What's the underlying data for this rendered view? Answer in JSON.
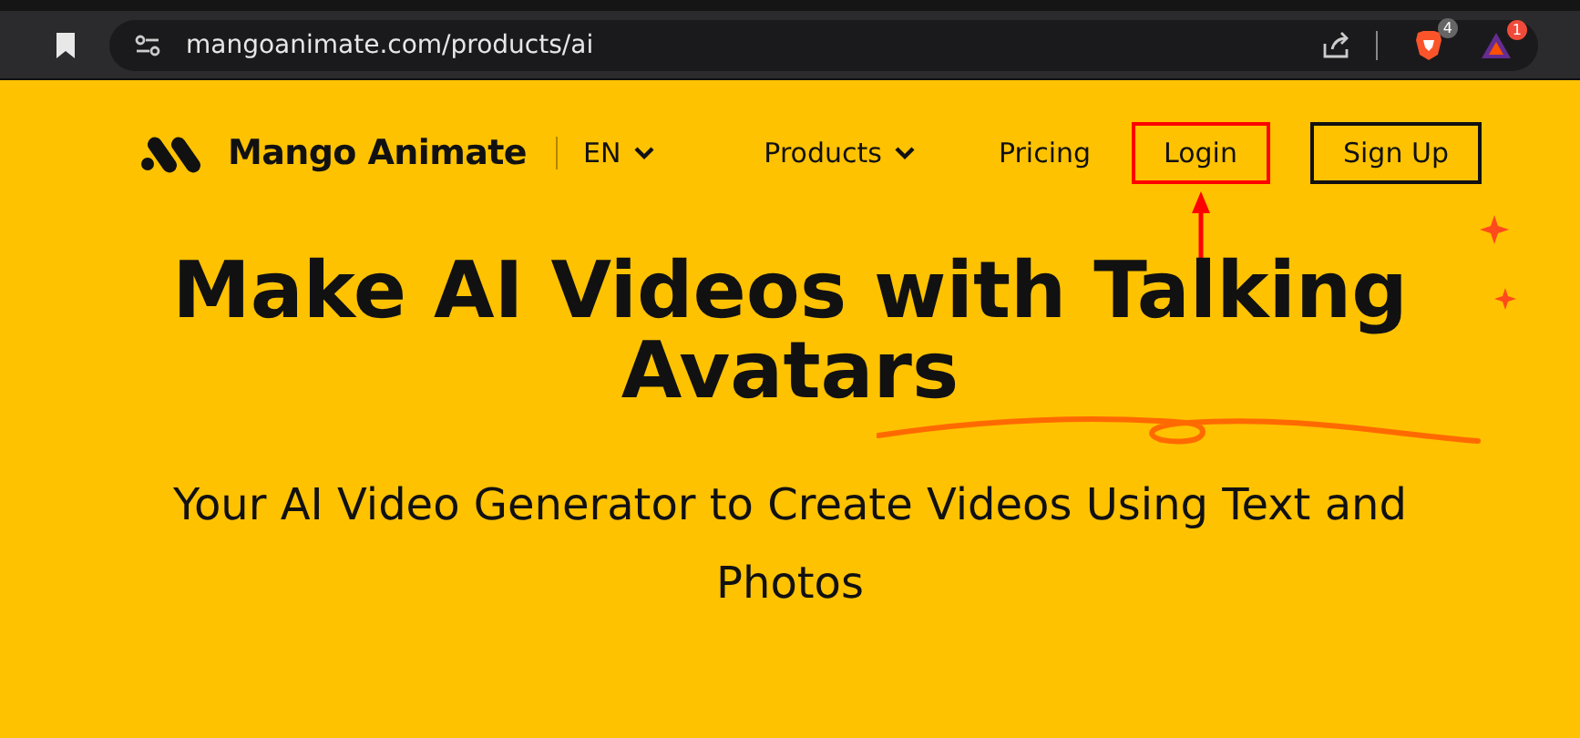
{
  "browser": {
    "url": "mangoanimate.com/products/ai",
    "extensions": [
      {
        "kind": "shield",
        "badge": "4"
      },
      {
        "kind": "triangle",
        "badge": "1"
      }
    ]
  },
  "nav": {
    "logo": "Mango Animate",
    "language": "EN",
    "items": [
      {
        "label": "Products",
        "kind": "dropdown",
        "highlighted": false
      },
      {
        "label": "Pricing",
        "kind": "link",
        "highlighted": false
      },
      {
        "label": "Login",
        "kind": "link",
        "highlighted": true
      },
      {
        "label": "Sign Up",
        "kind": "outlined",
        "highlighted": false
      }
    ]
  },
  "hero": {
    "title": "Make AI Videos with Talking Avatars",
    "subtitle": "Your AI Video Generator to Create Videos Using Text and Photos"
  }
}
